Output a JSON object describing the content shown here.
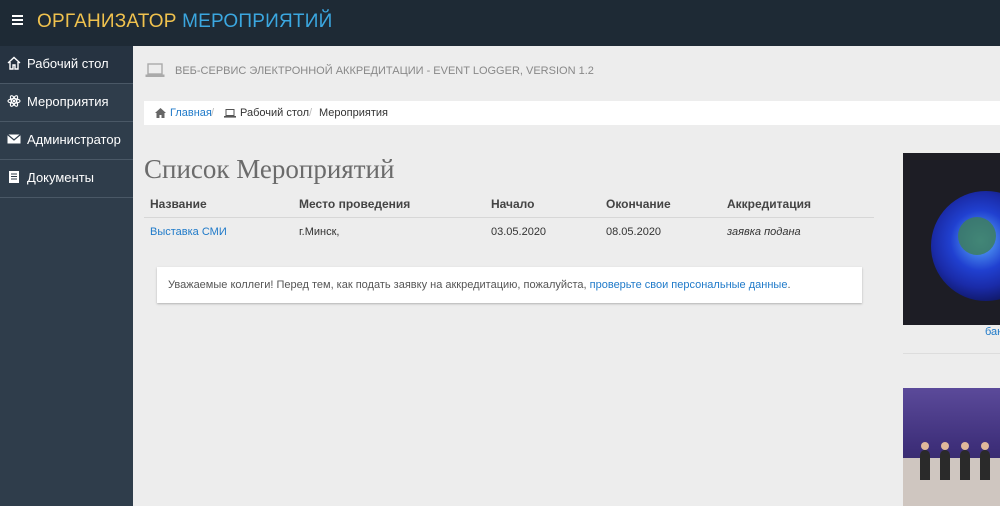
{
  "brand": {
    "part1": "ОРГАНИЗАТОР",
    "part2": "МЕРОПРИЯТИЙ"
  },
  "sidebar": {
    "items": [
      {
        "label": "Рабочий стол",
        "icon": "home-icon",
        "active": true
      },
      {
        "label": "Мероприятия",
        "icon": "atom-icon",
        "active": false
      },
      {
        "label": "Администратор",
        "icon": "envelope-icon",
        "active": false
      },
      {
        "label": "Документы",
        "icon": "book-icon",
        "active": false
      }
    ]
  },
  "header": {
    "text": "ВЕБ-СЕРВИС ЭЛЕКТРОННОЙ АККРЕДИТАЦИИ - EVENT LOGGER, VERSION 1.2"
  },
  "breadcrumb": {
    "home": "Главная",
    "desk": "Рабочий стол",
    "current": "Мероприятия"
  },
  "page": {
    "title": "Список Мероприятий"
  },
  "table": {
    "headers": [
      "Название",
      "Место проведения",
      "Начало",
      "Окончание",
      "Аккредитация"
    ],
    "rows": [
      {
        "name": "Выставка СМИ",
        "place": "г.Минск,",
        "start": "03.05.2020",
        "end": "08.05.2020",
        "status": "заявка подана"
      }
    ]
  },
  "notice": {
    "text": "Уважаемые коллеги! Перед тем, как подать заявку на аккредитацию, пожалуйста, ",
    "link": "проверьте свои персональные данные",
    "suffix": "."
  },
  "aside": {
    "caption1": "бан"
  },
  "colors": {
    "topbar": "#1e2a35",
    "sidebar": "#2f3d4b",
    "brand_yellow": "#f0c24e",
    "brand_blue": "#3ba7e0",
    "link": "#1f7ac9"
  }
}
